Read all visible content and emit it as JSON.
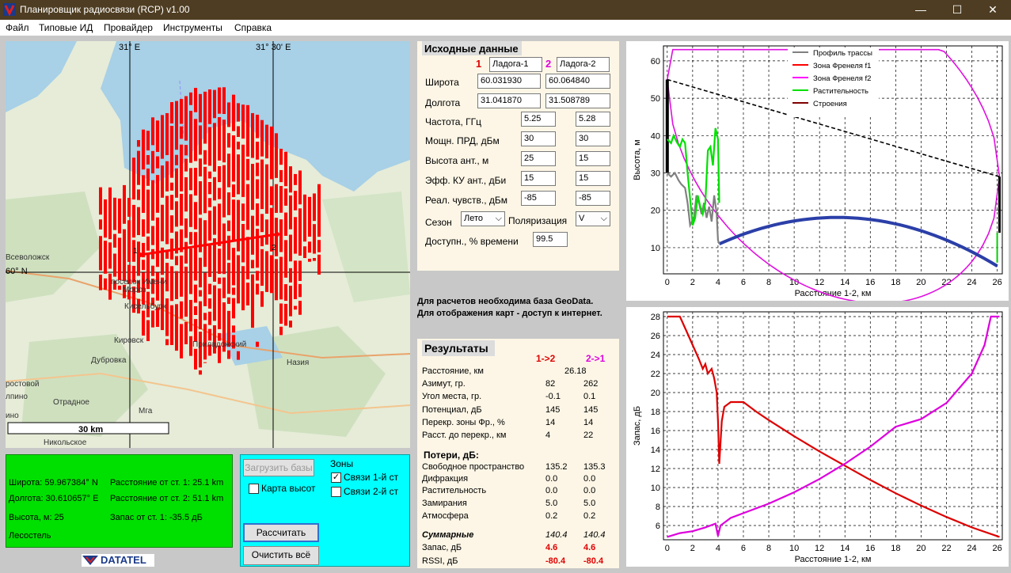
{
  "window": {
    "title": "Планировщик радиосвязи  (RCP) v1.00",
    "controls": [
      "—",
      "☐",
      "✕"
    ]
  },
  "menu": [
    "Файл",
    "Типовые ИД",
    "Провайдер",
    "Инструменты",
    "Справка"
  ],
  "map": {
    "grid_labels": {
      "lon1": "31° E",
      "lon2": "31° 30' E",
      "lat": "60° N"
    },
    "places": [
      "Всеволожск",
      "Кировск",
      "Дубровка",
      "Приладожский",
      "Назия",
      "Отрадное",
      "Мга",
      "Никольское",
      "Мороз",
      "Кисельбурк",
      "поселок Имени",
      "ино",
      "ростовой",
      "лпино"
    ],
    "station_labels": [
      "1",
      "2"
    ],
    "scale": "30 km"
  },
  "info": {
    "lat": "Широта: 59.967384° N",
    "lon": "Долгота: 30.610657° E",
    "height": "Высота, м: 25",
    "terrain": "Лесостель",
    "dist1": "Расстояние от ст. 1: 25.1 km",
    "dist2": "Расстояние от ст. 2: 51.1 km",
    "margin": "Запас от ст. 1: -35.5 дБ"
  },
  "controls": {
    "load_db": "Загрузить базы",
    "height_map": "Карта высот",
    "zones": "Зоны",
    "zone1": "Связи 1-й ст",
    "zone2": "Связи 2-й ст",
    "calc": "Рассчитать",
    "clear": "Очистить всё"
  },
  "logo": "DATATEL",
  "inputs": {
    "title": "Исходные данные",
    "st1_num": "1",
    "st2_num": "2",
    "st1_name": "Ладога-1",
    "st2_name": "Ладога-2",
    "rows": [
      {
        "label": "Широта",
        "v1": "60.031930",
        "v2": "60.064840"
      },
      {
        "label": "Долгота",
        "v1": "31.041870",
        "v2": "31.508789"
      },
      {
        "label": "Частота, ГГц",
        "v1": "5.25",
        "v2": "5.28"
      },
      {
        "label": "Мощн. ПРД, дБм",
        "v1": "30",
        "v2": "30"
      },
      {
        "label": "Высота ант., м",
        "v1": "25",
        "v2": "15"
      },
      {
        "label": "Эфф. КУ ант., дБи",
        "v1": "15",
        "v2": "15"
      },
      {
        "label": "Реал. чувств., дБм",
        "v1": "-85",
        "v2": "-85"
      }
    ],
    "season_label": "Сезон",
    "season": "Лето",
    "polar_label": "Поляризация",
    "polar": "V",
    "avail_label": "Доступн., % времени",
    "avail": "99.5"
  },
  "notice": [
    "Для расчетов необходима база GeoData.",
    "Для отображения карт - доступ к интернет."
  ],
  "results": {
    "title": "Результаты",
    "h1": "1->2",
    "h2": "2->1",
    "distance_label": "Расстояние, км",
    "distance": "26.18",
    "rows": [
      {
        "label": "Азимут, гр.",
        "a": "82",
        "b": "262"
      },
      {
        "label": "Угол места, гр.",
        "a": "-0.1",
        "b": "0.1"
      },
      {
        "label": "Потенциал, дБ",
        "a": "145",
        "b": "145"
      },
      {
        "label": "Перекр. зоны Фр., %",
        "a": "14",
        "b": "14"
      },
      {
        "label": "Расст. до перекр., км",
        "a": "4",
        "b": "22"
      }
    ],
    "loss_title": "Потери, дБ:",
    "loss": [
      {
        "label": "Свободное пространство",
        "a": "135.2",
        "b": "135.3"
      },
      {
        "label": "Дифракция",
        "a": "0.0",
        "b": "0.0"
      },
      {
        "label": "Растительность",
        "a": "0.0",
        "b": "0.0"
      },
      {
        "label": "Замирания",
        "a": "5.0",
        "b": "5.0"
      },
      {
        "label": "Атмосфера",
        "a": "0.2",
        "b": "0.2"
      }
    ],
    "total_label": "Суммарные",
    "total_a": "140.4",
    "total_b": "140.4",
    "margin_label": "Запас, дБ",
    "margin_a": "4.6",
    "margin_b": "4.6",
    "rssi_label": "RSSI, дБ",
    "rssi_a": "-80.4",
    "rssi_b": "-80.4"
  },
  "chart_data": [
    {
      "type": "line",
      "xlabel": "Расстояние 1-2, км",
      "ylabel": "Высота, м",
      "xlim": [
        -0.3,
        26.4
      ],
      "ylim": [
        3,
        64
      ],
      "xticks": [
        0,
        2,
        4,
        6,
        8,
        10,
        12,
        14,
        16,
        18,
        20,
        22,
        24,
        26
      ],
      "yticks": [
        10,
        20,
        30,
        40,
        50,
        60
      ],
      "grid": true,
      "legend_position": "top-right",
      "series": [
        {
          "name": "Профиль трассы",
          "color": "#808080",
          "points": [
            [
              0,
              30
            ],
            [
              0.3,
              29
            ],
            [
              0.6,
              30
            ],
            [
              0.9,
              28
            ],
            [
              1.1,
              27
            ],
            [
              1.4,
              26
            ],
            [
              1.6,
              22
            ],
            [
              1.8,
              16
            ],
            [
              2.1,
              18
            ],
            [
              2.3,
              24
            ],
            [
              2.5,
              22
            ],
            [
              2.7,
              19
            ],
            [
              2.9,
              22
            ],
            [
              3.1,
              18
            ],
            [
              3.3,
              21
            ],
            [
              3.5,
              17
            ],
            [
              3.7,
              24
            ],
            [
              3.9,
              19
            ],
            [
              4.0,
              12
            ],
            [
              4.1,
              11
            ]
          ]
        },
        {
          "name": "Зона Френеля f1",
          "color": "#ff0000",
          "points": []
        },
        {
          "name": "Зона Френеля f2",
          "color": "#ff00ff",
          "points": []
        },
        {
          "name": "Растительность",
          "color": "#00e000",
          "points": [
            [
              0,
              39
            ],
            [
              0.3,
              38
            ],
            [
              0.5,
              40
            ],
            [
              0.8,
              38
            ],
            [
              1.0,
              37
            ],
            [
              1.2,
              39
            ],
            [
              1.4,
              38
            ],
            [
              1.6,
              30
            ],
            [
              1.8,
              23
            ],
            [
              2.0,
              16
            ],
            [
              2.2,
              18
            ],
            [
              2.4,
              24
            ],
            [
              2.6,
              21
            ],
            [
              2.8,
              19
            ],
            [
              3.0,
              22
            ],
            [
              3.2,
              36
            ],
            [
              3.4,
              37
            ],
            [
              3.6,
              32
            ],
            [
              3.8,
              42
            ],
            [
              4.0,
              39
            ],
            [
              4.1,
              22
            ]
          ]
        },
        {
          "name": "Строения",
          "color": "#800000",
          "points": []
        }
      ],
      "los": [
        [
          0,
          55
        ],
        [
          26.18,
          29
        ]
      ]
    },
    {
      "type": "line",
      "xlabel": "Расстояние 1-2, км",
      "ylabel": "Запас, дБ",
      "xlim": [
        -0.3,
        26.4
      ],
      "ylim": [
        4.5,
        28.5
      ],
      "xticks": [
        0,
        2,
        4,
        6,
        8,
        10,
        12,
        14,
        16,
        18,
        20,
        22,
        24,
        26
      ],
      "yticks": [
        6,
        8,
        10,
        12,
        14,
        16,
        18,
        20,
        22,
        24,
        26,
        28
      ],
      "grid": true,
      "series": [
        {
          "name": "",
          "color": "#dd0000",
          "points": [
            [
              0,
              28
            ],
            [
              1,
              28
            ],
            [
              1.5,
              26.5
            ],
            [
              2,
              25
            ],
            [
              2.5,
              23.5
            ],
            [
              2.8,
              22.5
            ],
            [
              3,
              23
            ],
            [
              3.2,
              22
            ],
            [
              3.5,
              22.5
            ],
            [
              3.7,
              21.5
            ],
            [
              3.9,
              20
            ],
            [
              4.0,
              17
            ],
            [
              4.1,
              12.5
            ],
            [
              4.3,
              17
            ],
            [
              4.5,
              18.5
            ],
            [
              5,
              19
            ],
            [
              6,
              19
            ],
            [
              7,
              18
            ],
            [
              8,
              17.1
            ],
            [
              10,
              15.4
            ],
            [
              12,
              13.8
            ],
            [
              14,
              12.3
            ],
            [
              16,
              10.8
            ],
            [
              18,
              9.4
            ],
            [
              20,
              8.1
            ],
            [
              22,
              6.9
            ],
            [
              24,
              5.8
            ],
            [
              26.18,
              4.8
            ]
          ]
        },
        {
          "name": "",
          "color": "#dd00dd",
          "points": [
            [
              0,
              4.8
            ],
            [
              1,
              5.2
            ],
            [
              2,
              5.4
            ],
            [
              3,
              5.8
            ],
            [
              3.8,
              6.2
            ],
            [
              4.0,
              4.9
            ],
            [
              4.2,
              6.0
            ],
            [
              5,
              6.8
            ],
            [
              6,
              7.3
            ],
            [
              8,
              8.3
            ],
            [
              10,
              9.5
            ],
            [
              12,
              10.9
            ],
            [
              14,
              12.5
            ],
            [
              16,
              14.3
            ],
            [
              18,
              16.4
            ],
            [
              20,
              17.2
            ],
            [
              22,
              18.9
            ],
            [
              24,
              22
            ],
            [
              25,
              25
            ],
            [
              25.5,
              28
            ],
            [
              26.18,
              28
            ]
          ]
        }
      ]
    }
  ]
}
